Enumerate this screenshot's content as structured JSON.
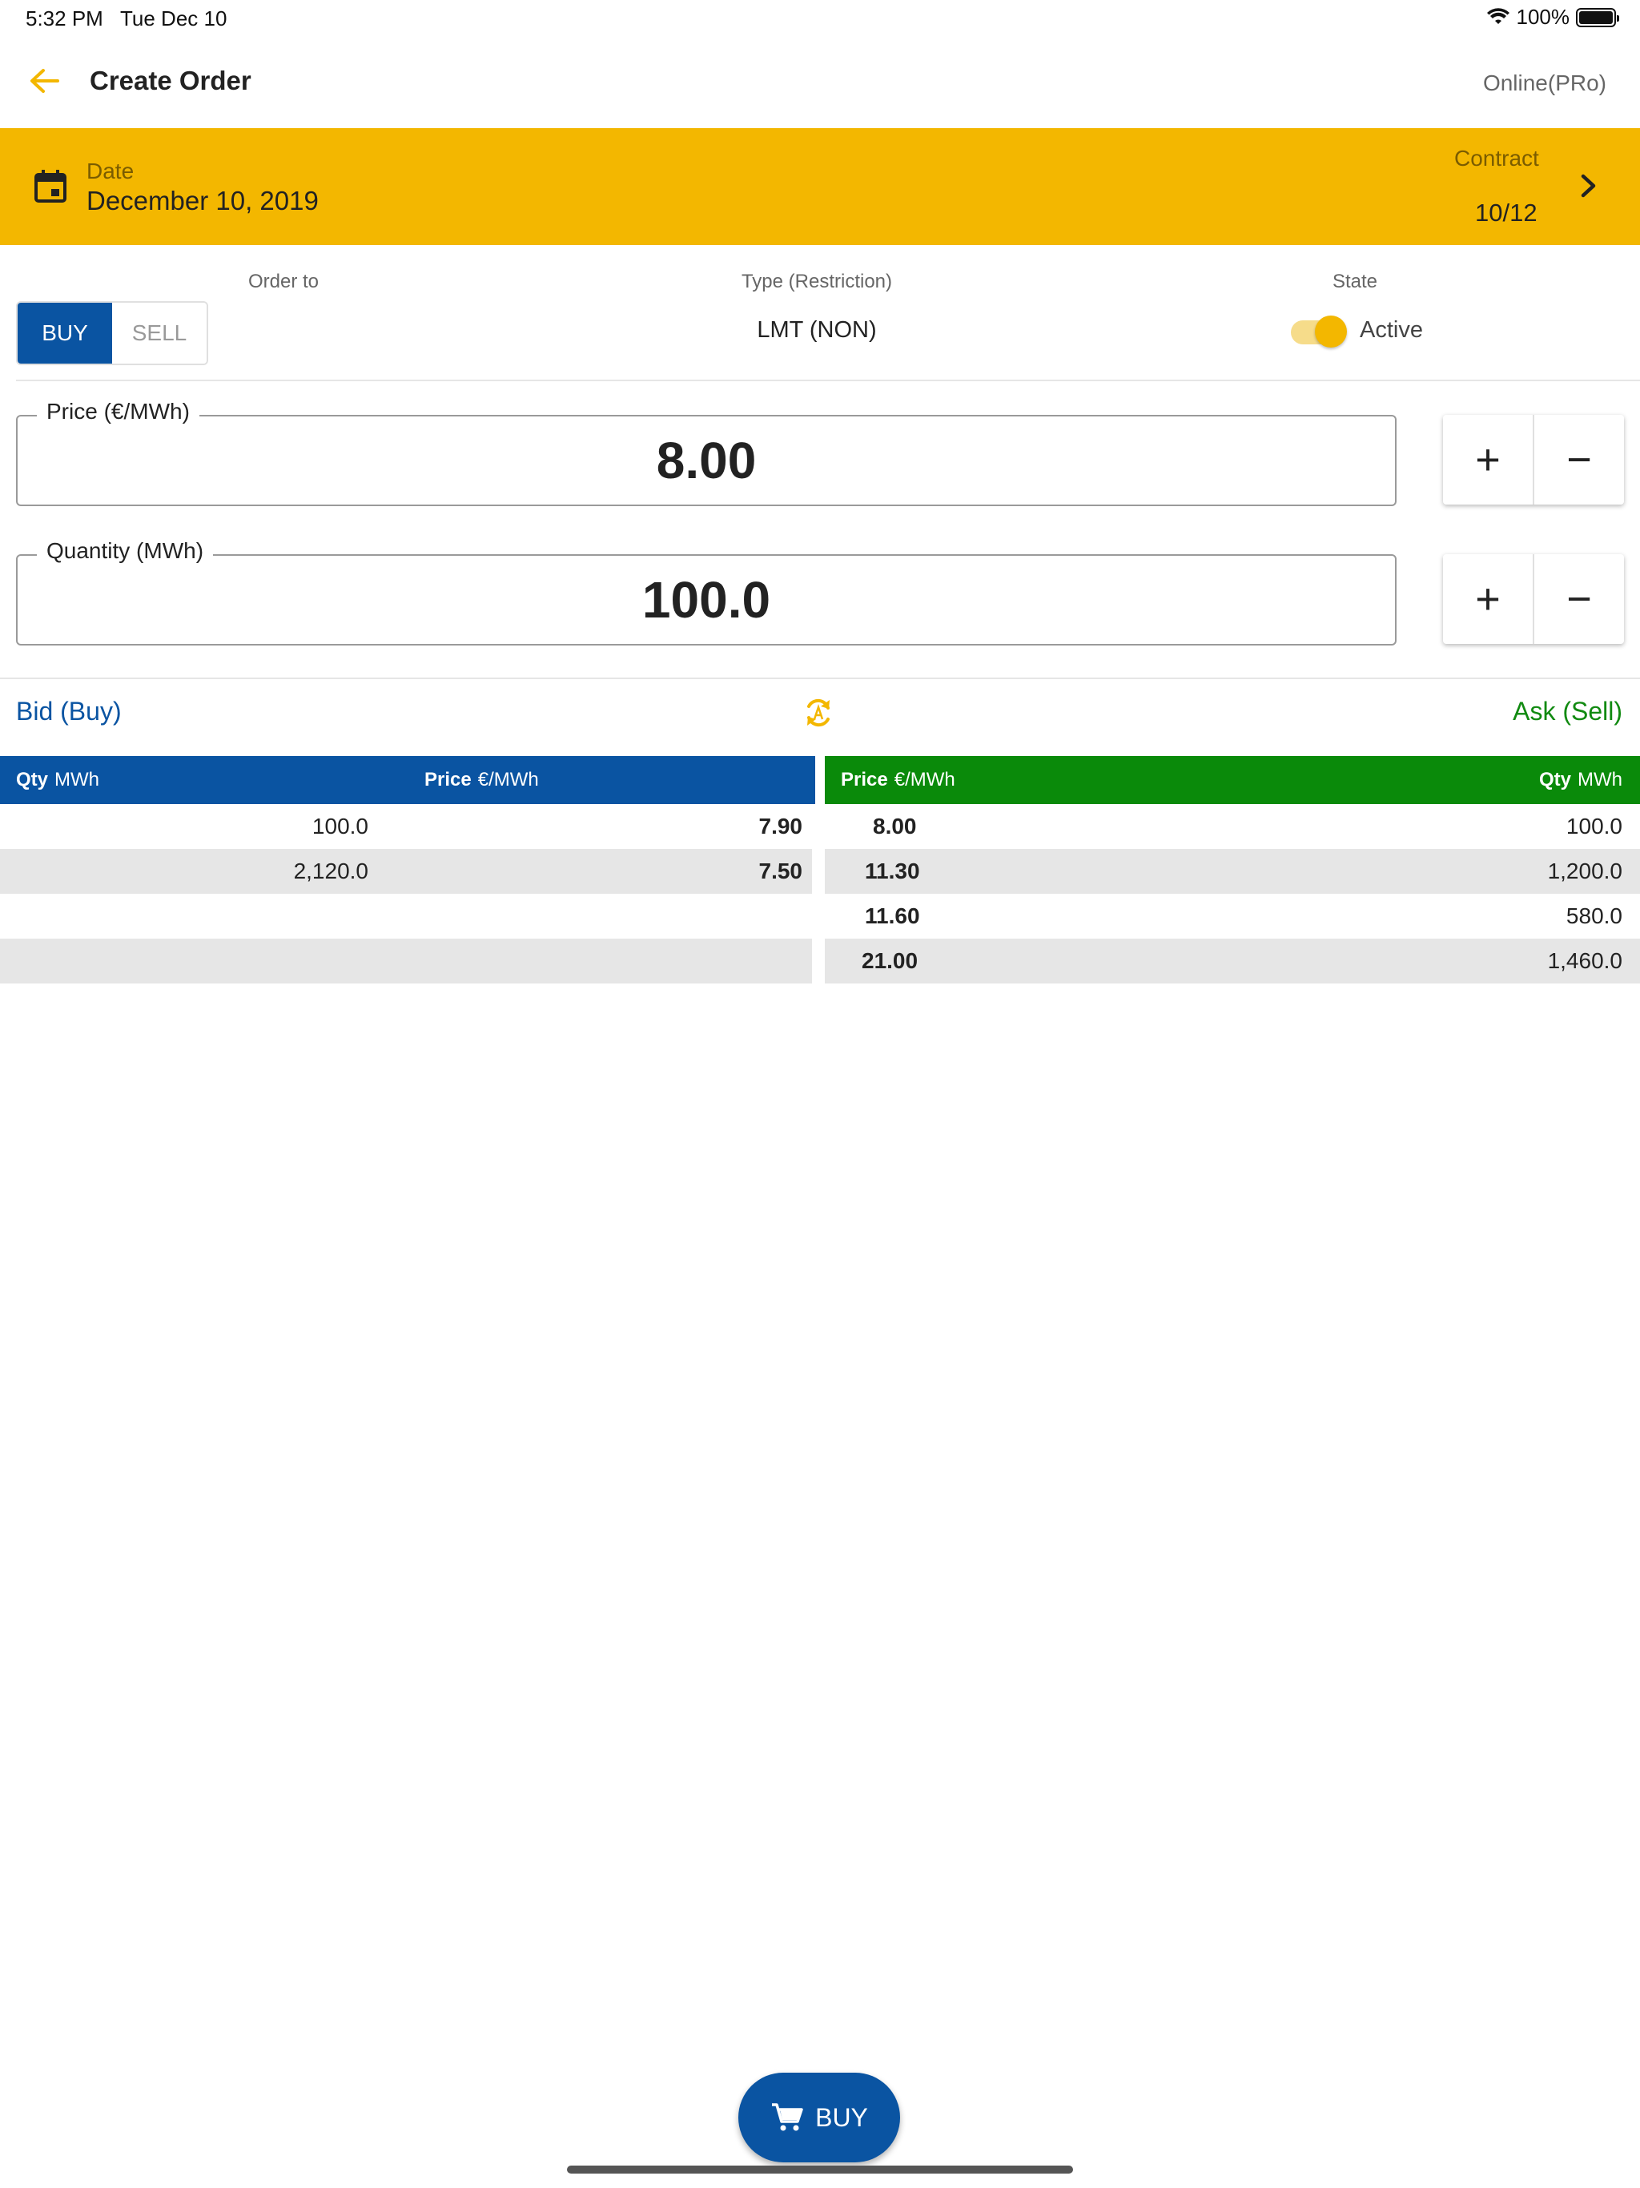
{
  "status_bar": {
    "time": "5:32 PM",
    "date": "Tue Dec 10",
    "battery": "100%"
  },
  "app_bar": {
    "title": "Create Order",
    "connection": "Online(PRo)"
  },
  "banner": {
    "date_label": "Date",
    "date_value": "December 10, 2019",
    "contract_label": "Contract",
    "contract_value": "10/12",
    "background": "#f3b700"
  },
  "order": {
    "order_to_label": "Order to",
    "buy_label": "BUY",
    "sell_label": "SELL",
    "type_label": "Type (Restriction)",
    "type_value": "LMT (NON)",
    "state_label": "State",
    "state_value": "Active",
    "state_on": true
  },
  "fields": {
    "price_label": "Price (€/MWh)",
    "price_value": "8.00",
    "quantity_label": "Quantity (MWh)",
    "quantity_value": "100.0",
    "plus": "+",
    "minus": "−"
  },
  "book": {
    "bid_title": "Bid (Buy)",
    "ask_title": "Ask (Sell)",
    "bid_headers": {
      "qty": "Qty",
      "qty_unit": "MWh",
      "price": "Price",
      "price_unit": "€/MWh"
    },
    "ask_headers": {
      "price": "Price",
      "price_unit": "€/MWh",
      "qty": "Qty",
      "qty_unit": "MWh"
    },
    "bids": [
      {
        "qty": "100.0",
        "price": "7.90"
      },
      {
        "qty": "2,120.0",
        "price": "7.50"
      },
      {
        "qty": "",
        "price": ""
      },
      {
        "qty": "",
        "price": ""
      }
    ],
    "asks": [
      {
        "price": "8.00",
        "qty": "100.0"
      },
      {
        "price": "11.30",
        "qty": "1,200.0"
      },
      {
        "price": "11.60",
        "qty": "580.0"
      },
      {
        "price": "21.00",
        "qty": "1,460.0"
      }
    ],
    "bid_color": "#0a54a2",
    "ask_color": "#0a8a0a"
  },
  "fab": {
    "label": "BUY",
    "icon": "cart-icon"
  }
}
